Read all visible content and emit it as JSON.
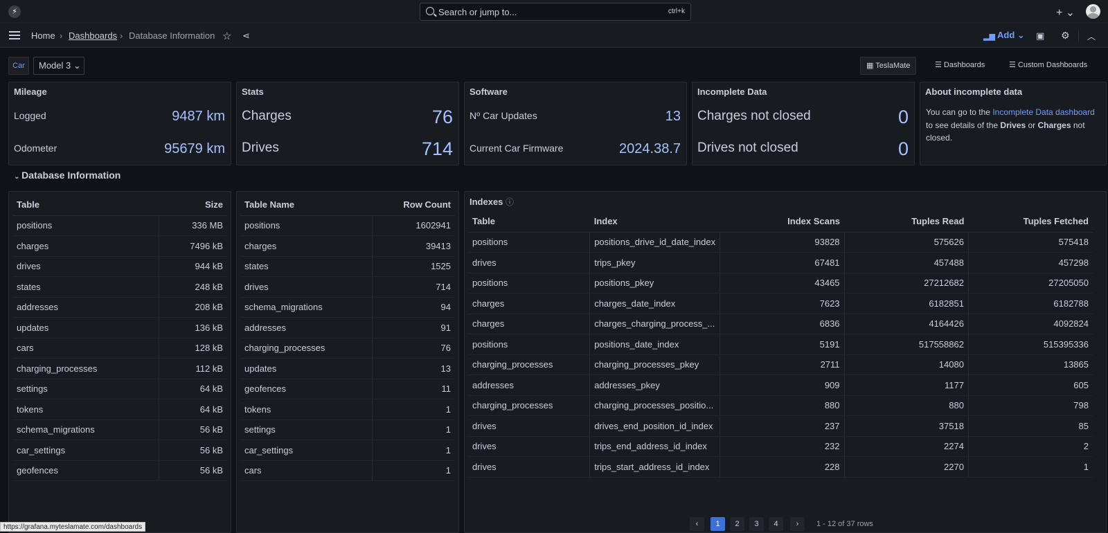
{
  "topbar": {
    "search_placeholder": "Search or jump to...",
    "shortcut": "ctrl+k",
    "new_label": "+ ⌄"
  },
  "nav": {
    "home": "Home",
    "dashboards": "Dashboards",
    "current": "Database Information",
    "add_label": "Add"
  },
  "variables": {
    "car_label": "Car",
    "model_value": "Model 3 ⌄"
  },
  "links": {
    "teslamate": "TeslaMate",
    "dashboards": "Dashboards",
    "custom": "Custom Dashboards"
  },
  "mileage": {
    "title": "Mileage",
    "logged_label": "Logged",
    "logged_value": "9487 km",
    "odometer_label": "Odometer",
    "odometer_value": "95679 km"
  },
  "stats": {
    "title": "Stats",
    "charges_label": "Charges",
    "charges_value": "76",
    "drives_label": "Drives",
    "drives_value": "714"
  },
  "software": {
    "title": "Software",
    "updates_label": "Nº Car Updates",
    "updates_value": "13",
    "firmware_label": "Current Car Firmware",
    "firmware_value": "2024.38.7"
  },
  "incomplete": {
    "title": "Incomplete Data",
    "charges_label": "Charges not closed",
    "charges_value": "0",
    "drives_label": "Drives not closed",
    "drives_value": "0"
  },
  "about": {
    "title": "About incomplete data",
    "text1": "You can go to the",
    "link": "Incomplete Data dashboard",
    "text2": "to see details of the",
    "drives": "Drives",
    "or": "or",
    "charges": "Charges",
    "text3": "not closed."
  },
  "row_title": "Database Information",
  "sizes": {
    "headers": [
      "Table",
      "Size"
    ],
    "rows": [
      [
        "positions",
        "336 MB"
      ],
      [
        "charges",
        "7496 kB"
      ],
      [
        "drives",
        "944 kB"
      ],
      [
        "states",
        "248 kB"
      ],
      [
        "addresses",
        "208 kB"
      ],
      [
        "updates",
        "136 kB"
      ],
      [
        "cars",
        "128 kB"
      ],
      [
        "charging_processes",
        "112 kB"
      ],
      [
        "settings",
        "64 kB"
      ],
      [
        "tokens",
        "64 kB"
      ],
      [
        "schema_migrations",
        "56 kB"
      ],
      [
        "car_settings",
        "56 kB"
      ],
      [
        "geofences",
        "56 kB"
      ]
    ]
  },
  "rowcounts": {
    "headers": [
      "Table Name",
      "Row Count"
    ],
    "rows": [
      [
        "positions",
        "1602941"
      ],
      [
        "charges",
        "39413"
      ],
      [
        "states",
        "1525"
      ],
      [
        "drives",
        "714"
      ],
      [
        "schema_migrations",
        "94"
      ],
      [
        "addresses",
        "91"
      ],
      [
        "charging_processes",
        "76"
      ],
      [
        "updates",
        "13"
      ],
      [
        "geofences",
        "11"
      ],
      [
        "tokens",
        "1"
      ],
      [
        "settings",
        "1"
      ],
      [
        "car_settings",
        "1"
      ],
      [
        "cars",
        "1"
      ]
    ]
  },
  "indexes": {
    "title": "Indexes",
    "headers": [
      "Table",
      "Index",
      "Index Scans",
      "Tuples Read",
      "Tuples Fetched"
    ],
    "rows": [
      [
        "positions",
        "positions_drive_id_date_index",
        "93828",
        "575626",
        "575418"
      ],
      [
        "drives",
        "trips_pkey",
        "67481",
        "457488",
        "457298"
      ],
      [
        "positions",
        "positions_pkey",
        "43465",
        "27212682",
        "27205050"
      ],
      [
        "charges",
        "charges_date_index",
        "7623",
        "6182851",
        "6182788"
      ],
      [
        "charges",
        "charges_charging_process_...",
        "6836",
        "4164426",
        "4092824"
      ],
      [
        "positions",
        "positions_date_index",
        "5191",
        "517558862",
        "515395336"
      ],
      [
        "charging_processes",
        "charging_processes_pkey",
        "2711",
        "14080",
        "13865"
      ],
      [
        "addresses",
        "addresses_pkey",
        "909",
        "1177",
        "605"
      ],
      [
        "charging_processes",
        "charging_processes_positio...",
        "880",
        "880",
        "798"
      ],
      [
        "drives",
        "drives_end_position_id_index",
        "237",
        "37518",
        "85"
      ],
      [
        "drives",
        "trips_end_address_id_index",
        "232",
        "2274",
        "2"
      ],
      [
        "drives",
        "trips_start_address_id_index",
        "228",
        "2270",
        "1"
      ]
    ]
  },
  "pager": {
    "prev": "‹",
    "pages": [
      "1",
      "2",
      "3",
      "4"
    ],
    "next": "›",
    "info": "1 - 12 of 37 rows"
  },
  "status_url": "https://grafana.myteslamate.com/dashboards"
}
